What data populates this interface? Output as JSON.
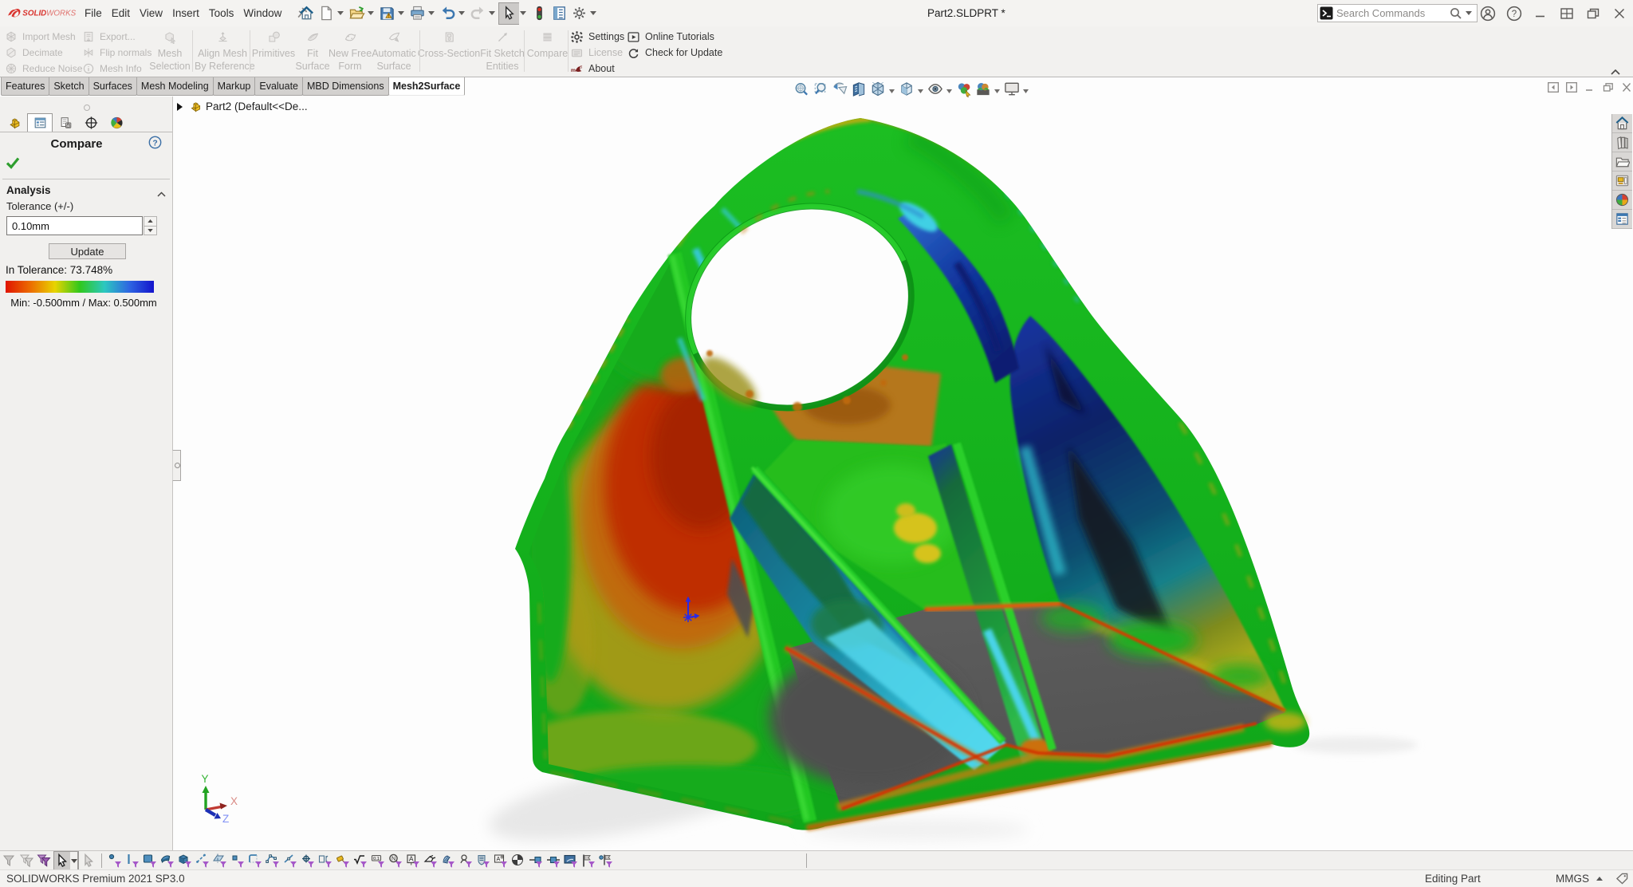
{
  "window": {
    "title": "Part2.SLDPRT *",
    "search_placeholder": "Search Commands",
    "brand_bold": "SOLID",
    "brand_light": "WORKS"
  },
  "menubar": {
    "items": [
      {
        "label": "File"
      },
      {
        "label": "Edit"
      },
      {
        "label": "View"
      },
      {
        "label": "Insert"
      },
      {
        "label": "Tools"
      },
      {
        "label": "Window"
      }
    ]
  },
  "qat": [
    {
      "name": "home-button",
      "glyph": "#g-home",
      "caret": false
    },
    {
      "name": "new-document-button",
      "glyph": "#g-newdoc",
      "caret": true
    },
    {
      "name": "open-button",
      "glyph": "#g-open",
      "caret": true
    },
    {
      "name": "save-button",
      "glyph": "#g-save",
      "caret": true
    },
    {
      "name": "print-button",
      "glyph": "#g-print",
      "caret": true
    },
    {
      "name": "undo-button",
      "glyph": "#g-undo",
      "caret": true
    },
    {
      "name": "redo-button",
      "glyph": "#g-redo",
      "caret": true
    },
    {
      "name": "select-tool-button",
      "glyph": "#g-cursor",
      "caret": true,
      "cls": "qat-sel"
    },
    {
      "name": "sketch-xpert-button",
      "glyph": "#g-stoplight",
      "caret": false
    },
    {
      "name": "evaluate-sheet-button",
      "glyph": "#g-sheet",
      "caret": false
    },
    {
      "name": "options-button",
      "glyph": "#g-gearline",
      "caret": true
    }
  ],
  "titlebar_right": [
    {
      "name": "login-icon",
      "glyph": "#g-person"
    },
    {
      "name": "help-icon",
      "glyph": "#g-helpcircle"
    },
    {
      "name": "minimize-icon",
      "glyph": "#g-winmin"
    },
    {
      "name": "viewports-icon",
      "glyph": "#g-wingrid"
    },
    {
      "name": "restore-icon",
      "glyph": "#g-winrestore"
    },
    {
      "name": "close-icon",
      "glyph": "#g-winclose"
    }
  ],
  "ribbon": {
    "col1": [
      {
        "label": "Import Mesh",
        "glyph": "#g-meshball",
        "name": "import-mesh-button"
      },
      {
        "label": "Decimate",
        "glyph": "#g-decimate",
        "name": "decimate-button"
      },
      {
        "label": "Reduce Noise",
        "glyph": "#g-noise",
        "name": "reduce-noise-button"
      }
    ],
    "col2": [
      {
        "label": "Export...",
        "glyph": "#g-export",
        "name": "export-button"
      },
      {
        "label": "Flip normals",
        "glyph": "#g-flip",
        "name": "flip-normals-button"
      },
      {
        "label": "Mesh Info",
        "glyph": "#g-info",
        "name": "mesh-info-button"
      }
    ],
    "big": [
      {
        "l1": "Mesh",
        "l2": "Selection",
        "glyph": "#g-meshsel",
        "css": "left:183px;width:60px",
        "name": "mesh-selection-button"
      },
      {
        "l1": "Align Mesh",
        "l2": "By Reference",
        "glyph": "#g-align",
        "css": "left:244px;width:70px",
        "name": "align-mesh-button"
      },
      {
        "l1": "Primitives",
        "l2": "",
        "glyph": "#g-primitives",
        "css": "left:314px;width:58px",
        "name": "primitives-button"
      },
      {
        "l1": "Fit",
        "l2": "Surface",
        "glyph": "#g-fitsurf",
        "css": "left:370px;width:44px",
        "name": "fit-surface-button"
      },
      {
        "l1": "New Free",
        "l2": "Form",
        "glyph": "#g-freeform",
        "css": "left:412px;width:54px",
        "name": "new-free-form-button"
      },
      {
        "l1": "Automatic",
        "l2": "Surface",
        "glyph": "#g-autosurf",
        "css": "left:461px;width:66px",
        "name": "automatic-surface-button"
      },
      {
        "l1": "Cross-Section",
        "l2": "",
        "glyph": "#g-crosssec",
        "css": "left:522px;width:82px",
        "name": "cross-section-button"
      },
      {
        "l1": "Fit Sketch",
        "l2": "Entities",
        "glyph": "#g-fitsketch",
        "css": "left:602px;width:56px",
        "name": "fit-sketch-entities-button"
      },
      {
        "l1": "Compare",
        "l2": "",
        "glyph": "#g-compare",
        "css": "left:659px;width:55px",
        "name": "compare-button"
      }
    ],
    "seps": [
      {
        "css": "left:241px"
      },
      {
        "css": "left:313px"
      },
      {
        "css": "left:526px"
      },
      {
        "css": "left:657px"
      },
      {
        "css": "left:712px"
      }
    ],
    "right1": [
      {
        "label": "Settings",
        "glyph": "#g-geardark",
        "dis": "",
        "name": "settings-button"
      },
      {
        "label": "License",
        "glyph": "#g-license",
        "dis": "dis",
        "name": "license-button"
      },
      {
        "label": "About",
        "glyph": "#g-about",
        "dis": "",
        "name": "about-button"
      }
    ],
    "right2": [
      {
        "label": "Online Tutorials",
        "glyph": "#g-tutorial",
        "dis": "",
        "name": "online-tutorials-button"
      },
      {
        "label": "Check for Update",
        "glyph": "#g-update",
        "dis": "",
        "name": "check-for-update-button"
      }
    ]
  },
  "tabs": [
    {
      "label": "Features"
    },
    {
      "label": "Sketch"
    },
    {
      "label": "Surfaces"
    },
    {
      "label": "Mesh Modeling"
    },
    {
      "label": "Markup"
    },
    {
      "label": "Evaluate"
    },
    {
      "label": "MBD Dimensions"
    },
    {
      "label": "Mesh2Surface",
      "cls": "active"
    }
  ],
  "feature_tree": {
    "root_item": "Part2  (Default<<De..."
  },
  "property_panel": {
    "title": "Compare",
    "analysis_section": "Analysis",
    "tolerance_label": "Tolerance (+/-)",
    "tolerance_value": "0.10mm",
    "update_label": "Update",
    "in_tolerance": "In Tolerance: 73.748%",
    "minmax": "Min: -0.500mm / Max: 0.500mm",
    "legend_colors": [
      "#e01400",
      "#ec6c00",
      "#e8d400",
      "#30c81c",
      "#2cc8c0",
      "#2e66e2",
      "#1414cc"
    ]
  },
  "headsup": [
    {
      "name": "zoom-to-fit-icon",
      "glyph": "#g-hu-zoomfit",
      "caret": false
    },
    {
      "name": "zoom-to-area-icon",
      "glyph": "#g-hu-zoomarea",
      "caret": false
    },
    {
      "name": "previous-view-icon",
      "glyph": "#g-hu-prev",
      "caret": false
    },
    {
      "name": "section-view-icon",
      "glyph": "#g-hu-section",
      "caret": false
    },
    {
      "name": "view-orientation-icon",
      "glyph": "#g-hu-orient",
      "caret": true
    },
    {
      "name": "display-style-icon",
      "glyph": "#g-hu-style",
      "caret": true
    },
    {
      "name": "hide-show-items-icon",
      "glyph": "#g-hu-eye",
      "caret": true
    },
    {
      "name": "edit-appearance-icon",
      "glyph": "#g-hu-appearance",
      "caret": false
    },
    {
      "name": "apply-scene-icon",
      "glyph": "#g-hu-scene",
      "caret": true
    },
    {
      "name": "view-settings-icon",
      "glyph": "#g-hu-monitor",
      "caret": true
    }
  ],
  "doc_controls": [
    {
      "name": "previous-window-icon",
      "glyph": "#g-doc-prev"
    },
    {
      "name": "next-window-icon",
      "glyph": "#g-doc-next"
    },
    {
      "name": "doc-minimize-icon",
      "glyph": "#g-doc-min"
    },
    {
      "name": "doc-restore-icon",
      "glyph": "#g-doc-restore"
    },
    {
      "name": "doc-close-icon",
      "glyph": "#g-doc-close"
    }
  ],
  "taskpane": [
    {
      "name": "home-tab-icon",
      "glyph": "#g-tp-home"
    },
    {
      "name": "design-library-icon",
      "glyph": "#g-tp-library"
    },
    {
      "name": "file-explorer-icon",
      "glyph": "#g-tp-folder"
    },
    {
      "name": "view-palette-icon",
      "glyph": "#g-tp-palette"
    },
    {
      "name": "appearances-icon",
      "glyph": "#g-tp-sphere"
    },
    {
      "name": "custom-properties-icon",
      "glyph": "#g-tp-props"
    }
  ],
  "pm_tabs": [
    {
      "name": "featuremanager-tab-icon",
      "glyph": "#g-pm-part",
      "cls": ""
    },
    {
      "name": "propertymanager-tab-icon",
      "glyph": "#g-pm-prop",
      "cls": "sel"
    },
    {
      "name": "configurationmanager-tab-icon",
      "glyph": "#g-pm-config",
      "cls": ""
    },
    {
      "name": "dimxpertmanager-tab-icon",
      "glyph": "#g-pm-dimx",
      "cls": ""
    },
    {
      "name": "displaymanager-tab-icon",
      "glyph": "#g-pm-display",
      "cls": ""
    }
  ],
  "sketchbar": [
    {
      "name": "filter-off-icon",
      "glyph": "#g-sk-funnel1"
    },
    {
      "name": "filter-items-icon",
      "glyph": "#g-sk-funnel2"
    },
    {
      "name": "filter-stack-icon",
      "glyph": "#g-sk-funnel3"
    },
    {
      "name": "select-arrow-tool",
      "glyph": "#g-sk-cursor",
      "cls": "sel",
      "caret": true
    },
    {
      "name": "lasso-select-icon",
      "glyph": "#g-sk-cursor2"
    },
    {
      "cls": "sep"
    },
    {
      "name": "filter-vertices-icon",
      "glyph": "#g-sk-point"
    },
    {
      "name": "filter-edges-icon",
      "glyph": "#g-sk-vline"
    },
    {
      "name": "filter-faces-icon",
      "glyph": "#g-sk-face"
    },
    {
      "name": "filter-surface-icon",
      "glyph": "#g-sk-wedge"
    },
    {
      "name": "filter-solid-icon",
      "glyph": "#g-sk-box"
    },
    {
      "name": "filter-axis-icon",
      "glyph": "#g-sk-diag"
    },
    {
      "name": "filter-plane-icon",
      "glyph": "#g-sk-plane"
    },
    {
      "name": "filter-sketchpoint-icon",
      "glyph": "#g-sk-sqdot"
    },
    {
      "name": "filter-sketch-icon",
      "glyph": "#g-sk-rect"
    },
    {
      "name": "filter-sketchseg-icon",
      "glyph": "#g-sk-poly"
    },
    {
      "name": "filter-midpoint-icon",
      "glyph": "#g-sk-diag2"
    },
    {
      "name": "filter-centermark-icon",
      "glyph": "#g-sk-target"
    },
    {
      "name": "filter-dimension-icon",
      "glyph": "#g-sk-dim"
    },
    {
      "name": "filter-annotation-icon",
      "glyph": "#g-sk-eraser"
    },
    {
      "name": "filter-equation-icon",
      "glyph": "#g-sk-sqrt"
    },
    {
      "name": "filter-balloon-icon",
      "glyph": "#g-sk-tag"
    },
    {
      "name": "filter-zoomnote-icon",
      "glyph": "#g-sk-zoomn"
    },
    {
      "name": "filter-note-icon",
      "glyph": "#g-sk-abox"
    },
    {
      "name": "filter-weldsymbol-icon",
      "glyph": "#g-sk-slope"
    },
    {
      "name": "filter-hatch-icon",
      "glyph": "#g-sk-hatch"
    },
    {
      "name": "filter-draftquality-icon",
      "glyph": "#g-sk-head"
    },
    {
      "name": "filter-weldbead-icon",
      "glyph": "#g-sk-shield"
    },
    {
      "name": "filter-datum-icon",
      "glyph": "#g-sk-apic"
    },
    {
      "name": "filter-section-icon",
      "glyph": "#g-sk-pie"
    },
    {
      "name": "filter-routepoint-icon",
      "glyph": "#g-sk-pin1"
    },
    {
      "name": "filter-connection-icon",
      "glyph": "#g-sk-pin2"
    },
    {
      "name": "filter-media-icon",
      "glyph": "#g-sk-screen"
    },
    {
      "name": "filter-flag1-icon",
      "glyph": "#g-sk-flag1"
    },
    {
      "name": "filter-flag2-icon",
      "glyph": "#g-sk-flag2"
    },
    {
      "cls": "sep2"
    }
  ],
  "statusbar": {
    "left": "SOLIDWORKS Premium 2021 SP3.0",
    "editing": "Editing Part",
    "units": "MMGS"
  },
  "triad": {
    "x": "X",
    "y": "Y",
    "z": "Z"
  }
}
